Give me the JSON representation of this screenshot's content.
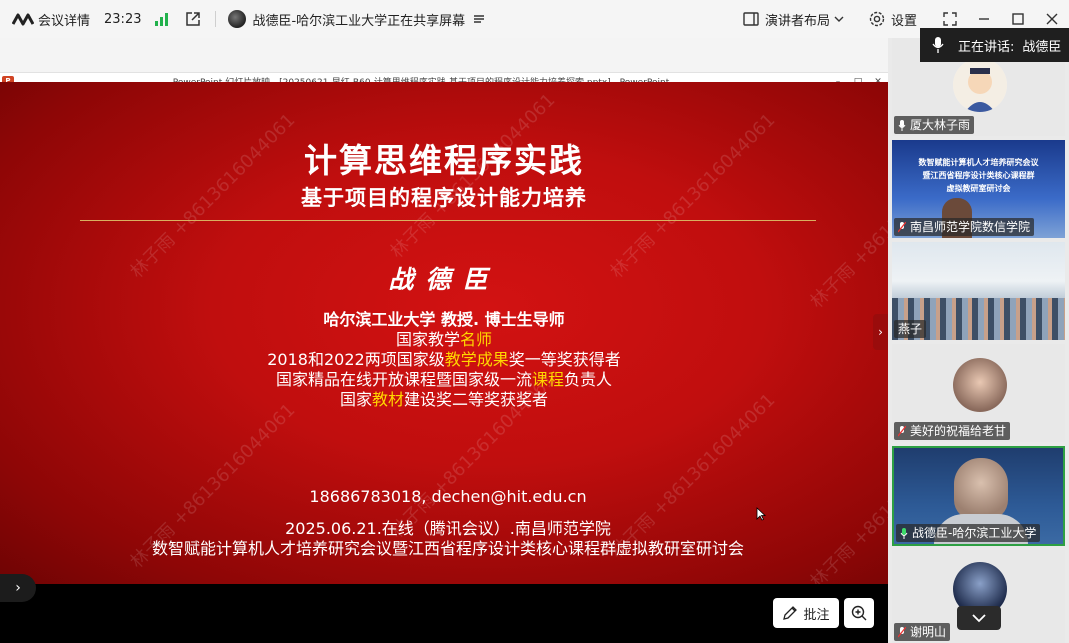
{
  "topbar": {
    "meeting_info_label": "会议详情",
    "clock": "23:23",
    "sharer_text": "战德臣-哈尔滨工业大学正在共享屏幕",
    "layout_label": "演讲者布局",
    "settings_label": "设置"
  },
  "ppt": {
    "window_title": "PowerPoint 幻灯片放映 - [20250621-早红-B60-计算思维程序实践-基于项目的程序设计能力培养探索.pptx] - PowerPoint",
    "icon_letter": "P"
  },
  "slide": {
    "title": "计算思维程序实践",
    "subtitle": "基于项目的程序设计能力培养",
    "speaker": "战德臣",
    "bio_line1": "哈尔滨工业大学  教授. 博士生导师",
    "bio_line2_a": "国家教学",
    "bio_line2_hl": "名师",
    "bio_line3_a": "2018和2022两项国家级",
    "bio_line3_hl": "教学成果",
    "bio_line3_b": "奖一等奖获得者",
    "bio_line4_a": "国家精品在线开放课程暨国家级一流",
    "bio_line4_hl": "课程",
    "bio_line4_b": "负责人",
    "bio_line5_a": "国家",
    "bio_line5_hl": "教材",
    "bio_line5_b": "建设奖二等奖获奖者",
    "contact": "18686783018, dechen@hit.edu.cn",
    "event_line1": "2025.06.21.在线（腾讯会议）.南昌师范学院",
    "event_line2": "数智赋能计算机人才培养研究会议暨江西省程序设计类核心课程群虚拟教研室研讨会",
    "watermark": "林子雨 +8613616044061",
    "highlight_color": "#ffd700"
  },
  "annotate_label": "批注",
  "speaking": {
    "label": "正在讲话:",
    "name": "战德臣"
  },
  "participants": [
    {
      "name": "厦大林子雨"
    },
    {
      "name": "南昌师范学院数信学院",
      "screen_line1": "数智赋能计算机人才培养研究会议",
      "screen_line2": "暨江西省程序设计类核心课程群",
      "screen_line3": "虚拟教研室研讨会"
    },
    {
      "name": "燕子"
    },
    {
      "name": "美好的祝福给老甘"
    },
    {
      "name": "战德臣-哈尔滨工业大学"
    },
    {
      "name": "谢明山"
    }
  ],
  "colors": {
    "slide_red": "#c00e0e",
    "active_border": "#2ea043",
    "signal_green": "#22b14c"
  }
}
